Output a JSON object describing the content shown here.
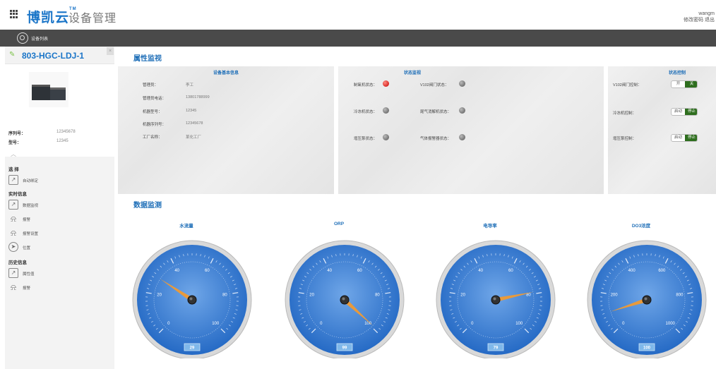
{
  "header": {
    "brand": "博凯云",
    "brand_tm": "TM",
    "subtitle": "设备管理",
    "username": "wangm",
    "links": "修改密码 退出"
  },
  "navbar": {
    "label": "设备列表"
  },
  "device": {
    "name": "803-HGC-LDJ-1",
    "serial_label": "序列号：",
    "serial_value": "12345678",
    "model_label": "型号：",
    "model_value": "12345"
  },
  "menu": {
    "group1": "选 择",
    "item1": "自动绑定",
    "group2": "实时信息",
    "item2": "数据监视",
    "item3": "报警",
    "item4": "报警设置",
    "item5": "位置",
    "group3": "历史信息",
    "item6": "属性值",
    "item7": "报警"
  },
  "attr_section": {
    "title": "属性监视"
  },
  "basic_info": {
    "title": "设备基本信息",
    "rows": [
      {
        "label": "管理员：",
        "value": "李工"
      },
      {
        "label": "管理员电话：",
        "value": "13801788999"
      },
      {
        "label": "机器型号：",
        "value": "12345"
      },
      {
        "label": "机器序列号：",
        "value": "12345678"
      },
      {
        "label": "工厂名称：",
        "value": "某化工厂"
      }
    ]
  },
  "status_monitor": {
    "title": "状态监视",
    "items": [
      {
        "label": "制氧机状态：",
        "state": "red"
      },
      {
        "label": "V102阀门状态：",
        "state": "gray"
      },
      {
        "label": "冷冻机状态：",
        "state": "gray"
      },
      {
        "label": "尾气消解机状态：",
        "state": "gray"
      },
      {
        "label": "增压泵状态：",
        "state": "gray"
      },
      {
        "label": "气体报警器状态：",
        "state": "gray"
      }
    ]
  },
  "status_control": {
    "title": "状态控制",
    "rows": [
      {
        "label": "V102阀门控制：",
        "opt1": "开",
        "opt2": "关"
      },
      {
        "label": "冷冻机控制：",
        "opt1": "启动",
        "opt2": "停止"
      },
      {
        "label": "增压泵控制：",
        "opt1": "启动",
        "opt2": "停止"
      }
    ]
  },
  "data_section": {
    "title": "数据监测"
  },
  "gauges": [
    {
      "title": "水流量",
      "value": 29,
      "min": 0,
      "max": 100,
      "ticks": [
        "0",
        "20",
        "40",
        "60",
        "80",
        "100"
      ],
      "display": "29"
    },
    {
      "title": "ORP",
      "value": 99,
      "min": 0,
      "max": 100,
      "ticks": [
        "0",
        "20",
        "40",
        "60",
        "80",
        "100"
      ],
      "display": "99"
    },
    {
      "title": "电导率",
      "value": 79,
      "min": 0,
      "max": 100,
      "ticks": [
        "0",
        "20",
        "40",
        "60",
        "80",
        "100"
      ],
      "display": "79"
    },
    {
      "title": "DO3浓度",
      "value": 100,
      "min": 0,
      "max": 1000,
      "ticks": [
        "0",
        "200",
        "400",
        "600",
        "800",
        "1000"
      ],
      "display": "100"
    }
  ],
  "colors": {
    "accent": "#1f6fb8",
    "gauge_face": "#1f65c2",
    "needle": "#e89a3c",
    "navbar": "#4a4a4a"
  }
}
